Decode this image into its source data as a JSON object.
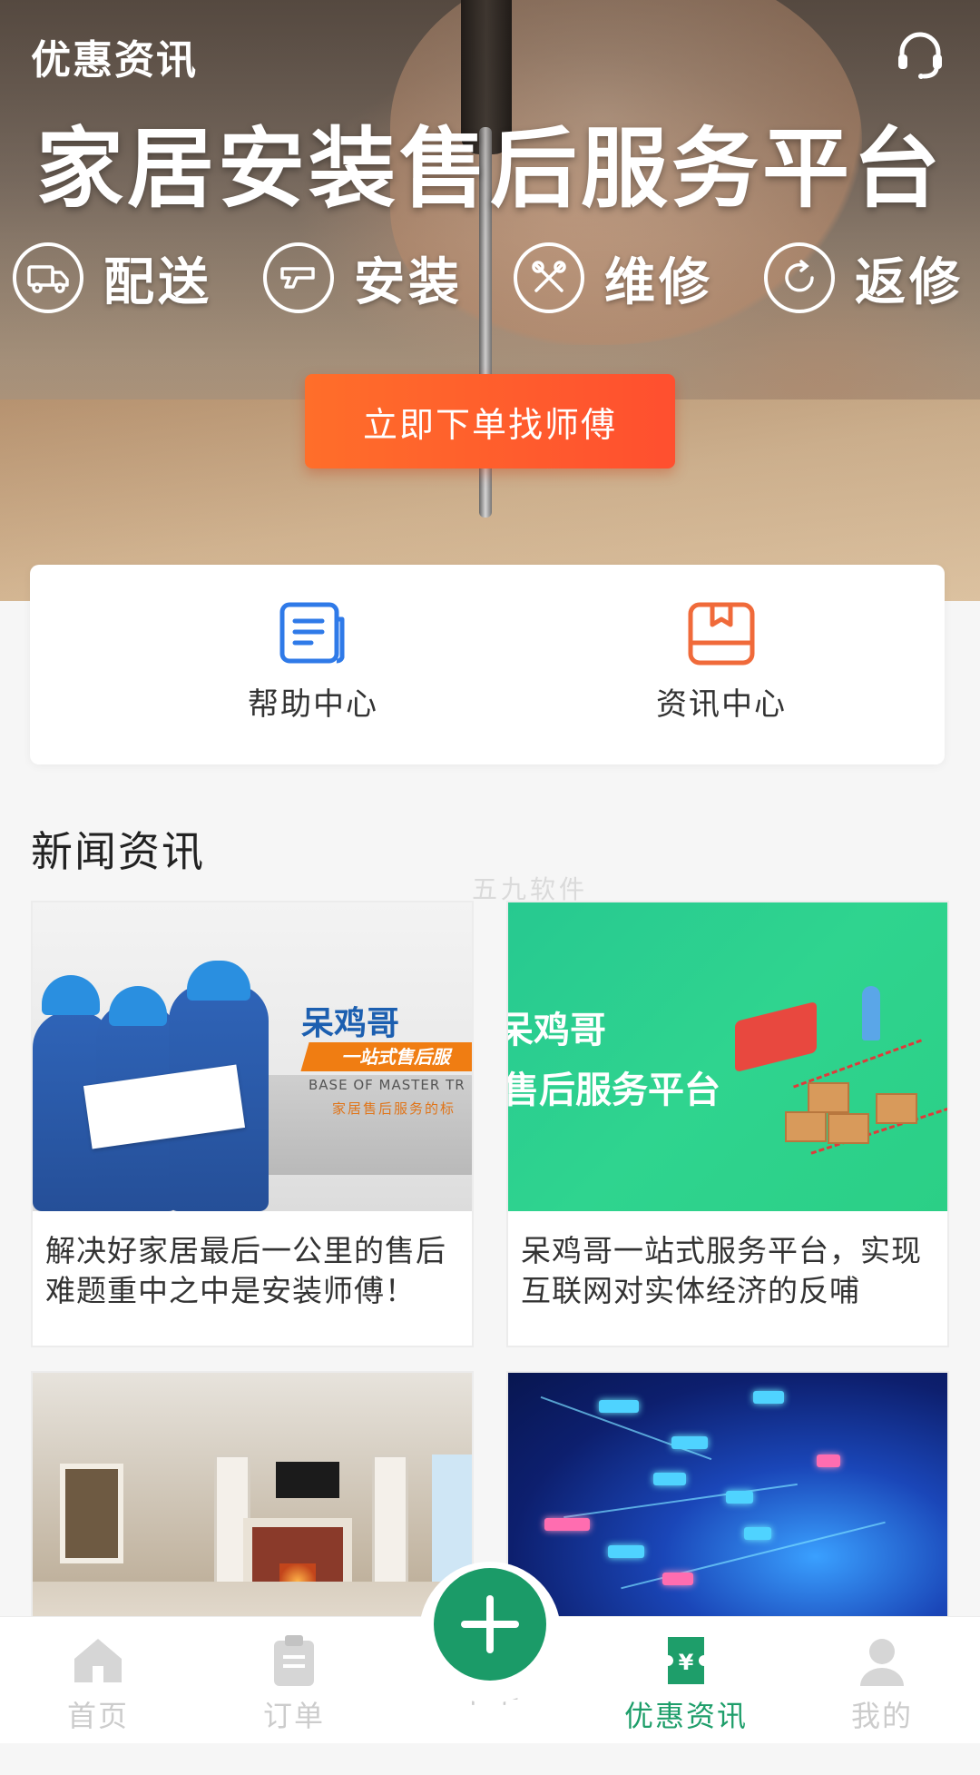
{
  "header": {
    "title": "优惠资讯",
    "support_icon": "headset-icon"
  },
  "banner": {
    "headline": "家居安装售后服务平台",
    "features": [
      {
        "label": "配送",
        "icon": "truck-icon"
      },
      {
        "label": "安装",
        "icon": "install-icon"
      },
      {
        "label": "维修",
        "icon": "repair-tools-icon"
      },
      {
        "label": "返修",
        "icon": "refresh-icon"
      }
    ],
    "cta_label": "立即下单找师傅"
  },
  "quick_links": [
    {
      "label": "帮助中心",
      "icon": "document-icon",
      "color": "#2f7ae8"
    },
    {
      "label": "资讯中心",
      "icon": "book-icon",
      "color": "#f06a3a"
    }
  ],
  "news": {
    "section_title": "新闻资讯",
    "watermark": "五九软件",
    "items": [
      {
        "title": "解决好家居最后一公里的售后难题重中之中是安装师傅！",
        "image": {
          "brand_cn": "呆鸡哥",
          "brand_slogan": "一站式售后服",
          "brand_en": "BASE OF MASTER TR",
          "brand_sub": "家居售后服务的标"
        }
      },
      {
        "title": "呆鸡哥一站式服务平台，实现互联网对实体经济的反哺",
        "image": {
          "line1": "呆鸡哥",
          "line2": "售后服务平台"
        }
      },
      {
        "title": "",
        "image": {}
      },
      {
        "title": "",
        "image": {}
      }
    ]
  },
  "bottom_nav": {
    "items": [
      {
        "label": "首页",
        "icon": "home-icon",
        "active": false
      },
      {
        "label": "订单",
        "icon": "clipboard-icon",
        "active": false
      },
      {
        "label": "下单",
        "icon": "plus-icon",
        "active": false
      },
      {
        "label": "优惠资讯",
        "icon": "coupon-icon",
        "active": true
      },
      {
        "label": "我的",
        "icon": "user-icon",
        "active": false
      }
    ],
    "active_color": "#1e9e6a",
    "inactive_color": "#cccccc"
  }
}
